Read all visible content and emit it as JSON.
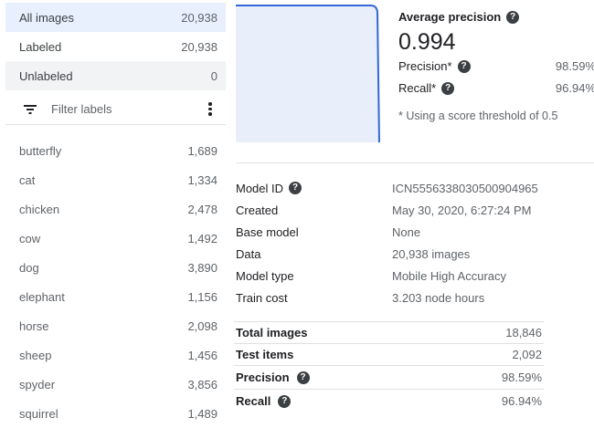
{
  "counts": [
    {
      "label": "All images",
      "value": "20,938"
    },
    {
      "label": "Labeled",
      "value": "20,938"
    },
    {
      "label": "Unlabeled",
      "value": "0"
    }
  ],
  "filter": {
    "placeholder": "Filter labels",
    "icon": "filter-icon",
    "menu_icon": "more-vert-icon"
  },
  "labels": [
    {
      "name": "butterfly",
      "count": "1,689"
    },
    {
      "name": "cat",
      "count": "1,334"
    },
    {
      "name": "chicken",
      "count": "2,478"
    },
    {
      "name": "cow",
      "count": "1,492"
    },
    {
      "name": "dog",
      "count": "3,890"
    },
    {
      "name": "elephant",
      "count": "1,156"
    },
    {
      "name": "horse",
      "count": "2,098"
    },
    {
      "name": "sheep",
      "count": "1,456"
    },
    {
      "name": "spyder",
      "count": "3,856"
    },
    {
      "name": "squirrel",
      "count": "1,489"
    }
  ],
  "metrics": {
    "ap_title": "Average precision",
    "ap_value": "0.994",
    "precision_label": "Precision*",
    "precision_value": "98.59%",
    "recall_label": "Recall*",
    "recall_value": "96.94%",
    "note": "* Using a score threshold of 0.5"
  },
  "model": [
    {
      "key": "Model ID",
      "value": "ICN5556338030500904965",
      "help": true
    },
    {
      "key": "Created",
      "value": "May 30, 2020, 6:27:24 PM"
    },
    {
      "key": "Base model",
      "value": "None"
    },
    {
      "key": "Data",
      "value": "20,938 images"
    },
    {
      "key": "Model type",
      "value": "Mobile High Accuracy"
    },
    {
      "key": "Train cost",
      "value": "3.203 node hours"
    }
  ],
  "stats": [
    {
      "key": "Total images",
      "value": "18,846"
    },
    {
      "key": "Test items",
      "value": "2,092"
    },
    {
      "key": "Precision",
      "value": "98.59%",
      "help": true
    },
    {
      "key": "Recall",
      "value": "96.94%",
      "help": true
    }
  ],
  "colors": {
    "accent": "#3367d6",
    "fill": "#e8eefa",
    "selected_bg": "#e8f0fe",
    "hover_bg": "#f1f3f4"
  }
}
